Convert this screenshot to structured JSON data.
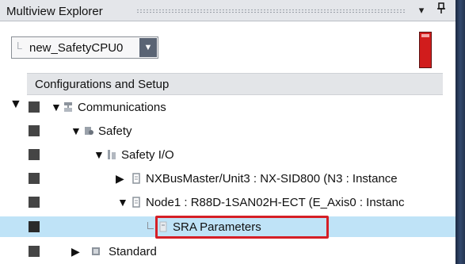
{
  "window": {
    "title": "Multiview Explorer",
    "pin_icon": "pin-icon",
    "menu_icon": "chevron-down-icon"
  },
  "device_selector": {
    "prefix": "L",
    "value": "new_SafetyCPU0",
    "arrow_icon": "chevron-down-icon"
  },
  "safety_indicator": {
    "color": "#d11c1c"
  },
  "tree": {
    "root_label": "Configurations and Setup",
    "nodes": [
      {
        "label": "Communications",
        "icon": "communications-icon"
      },
      {
        "label": "Safety",
        "icon": "safety-icon"
      },
      {
        "label": "Safety I/O",
        "icon": "safety-io-icon"
      },
      {
        "label": "NXBusMaster/Unit3 : NX-SID800 (N3 : Instance",
        "icon": "nx-unit-icon"
      },
      {
        "label": "Node1 : R88D-1SAN02H-ECT (E_Axis0 : Instanc",
        "icon": "servo-node-icon"
      },
      {
        "label": "SRA Parameters",
        "icon": "parameters-icon"
      },
      {
        "label": "Standard",
        "icon": "standard-icon"
      }
    ]
  },
  "colors": {
    "selection": "#bfe3f7",
    "highlight": "#d51f26"
  }
}
